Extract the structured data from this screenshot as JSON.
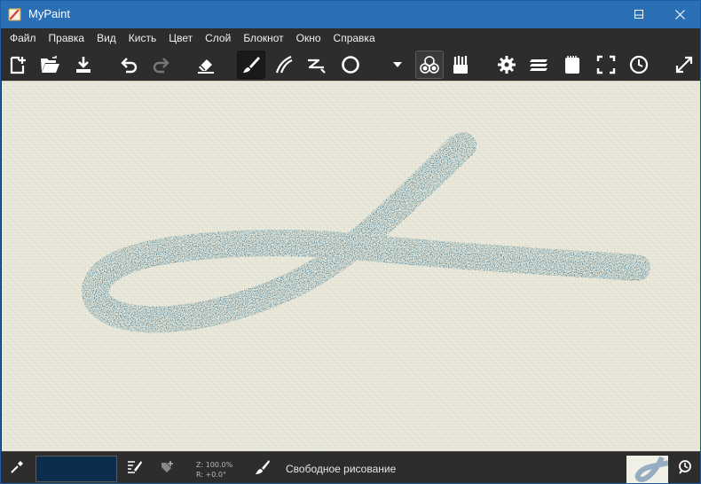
{
  "window": {
    "title": "MyPaint",
    "minimize_icon": "minimize-icon",
    "maximize_icon": "maximize-icon",
    "close_icon": "close-icon"
  },
  "menu": {
    "items": [
      "Файл",
      "Правка",
      "Вид",
      "Кисть",
      "Цвет",
      "Слой",
      "Блокнот",
      "Окно",
      "Справка"
    ]
  },
  "toolbar": {
    "buttons": [
      {
        "name": "new-document-icon"
      },
      {
        "name": "open-file-icon"
      },
      {
        "name": "save-file-icon"
      },
      {
        "name": "undo-icon"
      },
      {
        "name": "redo-icon"
      },
      {
        "name": "eraser-icon"
      },
      {
        "name": "freehand-brush-icon",
        "active": true
      },
      {
        "name": "inking-tool-icon"
      },
      {
        "name": "line-tool-icon"
      },
      {
        "name": "ellipse-tool-icon"
      },
      {
        "name": "dropdown-arrow-icon"
      },
      {
        "name": "color-circles-icon"
      },
      {
        "name": "brushes-icon"
      },
      {
        "name": "settings-gear-icon"
      },
      {
        "name": "layers-icon"
      },
      {
        "name": "scratchpad-icon"
      },
      {
        "name": "fullscreen-icon"
      },
      {
        "name": "clock-icon"
      },
      {
        "name": "expand-arrows-icon"
      }
    ]
  },
  "colors": {
    "canvas": "#e9e8d8",
    "stroke": "#3a7792",
    "current_color": "#0d2d4f",
    "titlebar": "#2b6fb5",
    "chrome": "#2d2d2d"
  },
  "statusbar": {
    "zoom": "Z: 100.0%",
    "rotation": "R: +0.0°",
    "mode": "Свободное рисование",
    "color_picker_icon": "eyedropper-icon",
    "brush_edit_icon": "brush-editor-icon",
    "add_icon": "add-to-favorites-icon",
    "brush_icon": "paintbrush-icon",
    "history_icon": "history-icon"
  }
}
